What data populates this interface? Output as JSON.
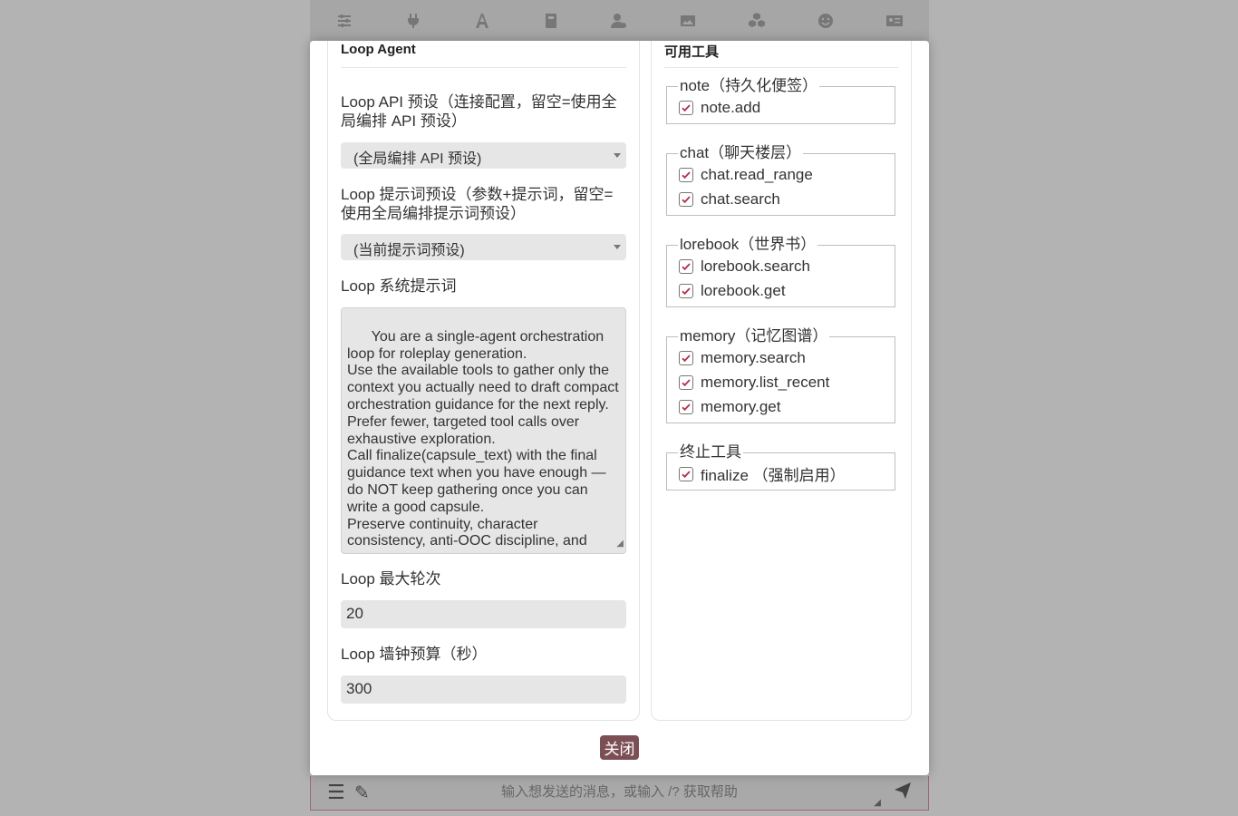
{
  "toolbar_icons": [
    "sliders-icon",
    "plug-icon",
    "font-icon",
    "book-icon",
    "user-gear-icon",
    "image-icon",
    "cubes-icon",
    "smile-icon",
    "contact-card-icon"
  ],
  "bottom": {
    "placeholder": "输入想发送的消息，或输入 /? 获取帮助"
  },
  "left": {
    "title": "Loop Agent",
    "api_label": "Loop API 预设（连接配置，留空=使用全局编排 API 预设）",
    "api_value": "(全局编排 API 预设)",
    "prompt_label": "Loop 提示词预设（参数+提示词，留空=使用全局编排提示词预设）",
    "prompt_value": "(当前提示词预设)",
    "system_label": "Loop 系统提示词",
    "system_text": "You are a single-agent orchestration loop for roleplay generation.\nUse the available tools to gather only the context you actually need to draft compact orchestration guidance for the next reply.\nPrefer fewer, targeted tool calls over exhaustive exploration.\nCall finalize(capsule_text) with the final guidance text when you have enough — do NOT keep gathering once you can write a good capsule.\nPreserve continuity, character consistency, anti-OOC discipline, and",
    "max_rounds_label": "Loop 最大轮次",
    "max_rounds_value": "20",
    "budget_label": "Loop 墙钟预算（秒）",
    "budget_value": "300"
  },
  "right": {
    "title": "可用工具",
    "groups": [
      {
        "legend": "note（持久化便签）",
        "items": [
          "note.add"
        ]
      },
      {
        "legend": "chat（聊天楼层）",
        "items": [
          "chat.read_range",
          "chat.search"
        ]
      },
      {
        "legend": "lorebook（世界书）",
        "items": [
          "lorebook.search",
          "lorebook.get"
        ]
      },
      {
        "legend": "memory（记忆图谱）",
        "items": [
          "memory.search",
          "memory.list_recent",
          "memory.get"
        ]
      },
      {
        "legend": "终止工具",
        "items": [
          "finalize （强制启用）"
        ]
      }
    ]
  },
  "close_label": "关闭",
  "colors": {
    "accent": "#7c4f55",
    "check": "#b5304c"
  }
}
